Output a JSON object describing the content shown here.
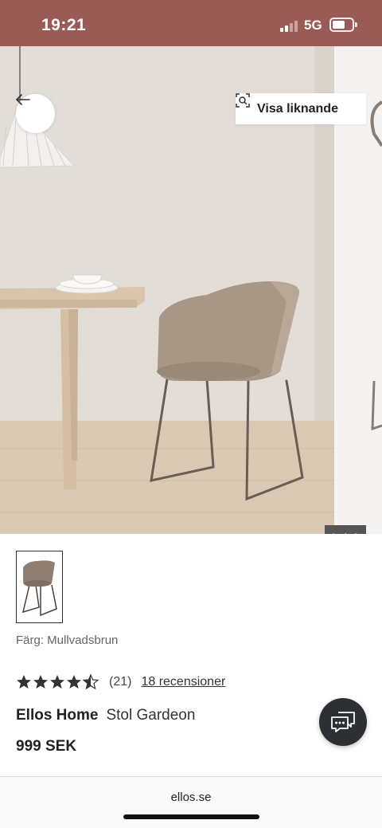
{
  "status_bar": {
    "time": "19:21",
    "network": "5G",
    "signal_level": "2 of 4 bars",
    "background_color": "#9a5a55"
  },
  "hero": {
    "back_icon": "arrow-left-icon",
    "similar_button": {
      "icon": "visual-search-icon",
      "label": "Visa liknande"
    },
    "image_counter": "1 / 6",
    "image_description_icon": "product-photo-chair"
  },
  "product": {
    "color_label": "Färg: Mullvadsbrun",
    "rating": {
      "stars": 4.5,
      "count_label": "(21)",
      "reviews_link": "18 recensioner"
    },
    "brand": "Ellos Home",
    "name": "Stol Gardeon",
    "price": "999 SEK"
  },
  "chat": {
    "icon": "chat-bubble-icon"
  },
  "browser": {
    "url": "ellos.se"
  }
}
